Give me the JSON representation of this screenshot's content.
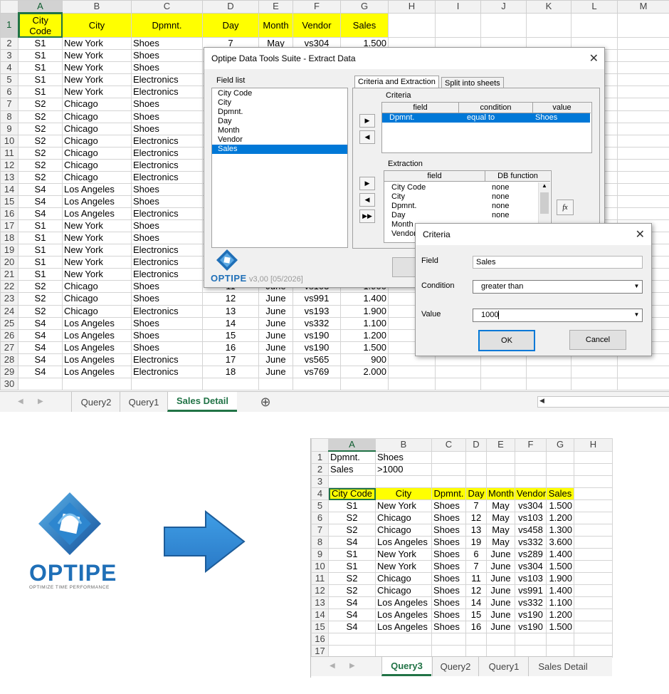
{
  "main_sheet": {
    "columns": [
      "A",
      "B",
      "C",
      "D",
      "E",
      "F",
      "G",
      "H",
      "I",
      "J",
      "K",
      "L",
      "M"
    ],
    "header_row": {
      "row": "1",
      "cells": [
        "City Code",
        "City",
        "Dpmnt.",
        "Day",
        "Month",
        "Vendor",
        "Sales"
      ]
    },
    "rows": [
      {
        "n": "2",
        "v": [
          "S1",
          "New York",
          "Shoes",
          "7",
          "May",
          "vs304",
          "1.500"
        ]
      },
      {
        "n": "3",
        "v": [
          "S1",
          "New York",
          "Shoes",
          "",
          "",
          "",
          ""
        ]
      },
      {
        "n": "4",
        "v": [
          "S1",
          "New York",
          "Shoes",
          "",
          "",
          "",
          ""
        ]
      },
      {
        "n": "5",
        "v": [
          "S1",
          "New York",
          "Electronics",
          "",
          "",
          "",
          ""
        ]
      },
      {
        "n": "6",
        "v": [
          "S1",
          "New York",
          "Electronics",
          "",
          "",
          "",
          ""
        ]
      },
      {
        "n": "7",
        "v": [
          "S2",
          "Chicago",
          "Shoes",
          "",
          "",
          "",
          ""
        ]
      },
      {
        "n": "8",
        "v": [
          "S2",
          "Chicago",
          "Shoes",
          "",
          "",
          "",
          ""
        ]
      },
      {
        "n": "9",
        "v": [
          "S2",
          "Chicago",
          "Shoes",
          "",
          "",
          "",
          ""
        ]
      },
      {
        "n": "10",
        "v": [
          "S2",
          "Chicago",
          "Electronics",
          "",
          "",
          "",
          ""
        ]
      },
      {
        "n": "11",
        "v": [
          "S2",
          "Chicago",
          "Electronics",
          "",
          "",
          "",
          ""
        ]
      },
      {
        "n": "12",
        "v": [
          "S2",
          "Chicago",
          "Electronics",
          "",
          "",
          "",
          ""
        ]
      },
      {
        "n": "13",
        "v": [
          "S2",
          "Chicago",
          "Electronics",
          "",
          "",
          "",
          ""
        ]
      },
      {
        "n": "14",
        "v": [
          "S4",
          "Los Angeles",
          "Shoes",
          "",
          "",
          "",
          ""
        ]
      },
      {
        "n": "15",
        "v": [
          "S4",
          "Los Angeles",
          "Shoes",
          "",
          "",
          "",
          ""
        ]
      },
      {
        "n": "16",
        "v": [
          "S4",
          "Los Angeles",
          "Electronics",
          "",
          "",
          "",
          ""
        ]
      },
      {
        "n": "17",
        "v": [
          "S1",
          "New York",
          "Shoes",
          "",
          "",
          "",
          ""
        ]
      },
      {
        "n": "18",
        "v": [
          "S1",
          "New York",
          "Shoes",
          "",
          "",
          "",
          ""
        ]
      },
      {
        "n": "19",
        "v": [
          "S1",
          "New York",
          "Electronics",
          "",
          "",
          "",
          ""
        ]
      },
      {
        "n": "20",
        "v": [
          "S1",
          "New York",
          "Electronics",
          "",
          "",
          "",
          ""
        ]
      },
      {
        "n": "21",
        "v": [
          "S1",
          "New York",
          "Electronics",
          "",
          "",
          "",
          ""
        ]
      },
      {
        "n": "22",
        "v": [
          "S2",
          "Chicago",
          "Shoes",
          "11",
          "June",
          "vs103",
          "1.900"
        ]
      },
      {
        "n": "23",
        "v": [
          "S2",
          "Chicago",
          "Shoes",
          "12",
          "June",
          "vs991",
          "1.400"
        ]
      },
      {
        "n": "24",
        "v": [
          "S2",
          "Chicago",
          "Electronics",
          "13",
          "June",
          "vs193",
          "1.900"
        ]
      },
      {
        "n": "25",
        "v": [
          "S4",
          "Los Angeles",
          "Shoes",
          "14",
          "June",
          "vs332",
          "1.100"
        ]
      },
      {
        "n": "26",
        "v": [
          "S4",
          "Los Angeles",
          "Shoes",
          "15",
          "June",
          "vs190",
          "1.200"
        ]
      },
      {
        "n": "27",
        "v": [
          "S4",
          "Los Angeles",
          "Shoes",
          "16",
          "June",
          "vs190",
          "1.500"
        ]
      },
      {
        "n": "28",
        "v": [
          "S4",
          "Los Angeles",
          "Electronics",
          "17",
          "June",
          "vs565",
          "900"
        ]
      },
      {
        "n": "29",
        "v": [
          "S4",
          "Los Angeles",
          "Electronics",
          "18",
          "June",
          "vs769",
          "2.000"
        ]
      },
      {
        "n": "30",
        "v": [
          "",
          "",
          "",
          "",
          "",
          "",
          ""
        ]
      }
    ],
    "tabs": [
      "Query2",
      "Query1",
      "Sales Detail"
    ],
    "add_sheet": "⊕"
  },
  "extract_dialog": {
    "title": "Optipe Data Tools Suite - Extract Data",
    "field_list_label": "Field list",
    "fields": [
      "City Code",
      "City",
      "Dpmnt.",
      "Day",
      "Month",
      "Vendor",
      "Sales"
    ],
    "selected_field": "Sales",
    "tabs": [
      "Criteria and Extraction",
      "Split into sheets"
    ],
    "criteria_label": "Criteria",
    "criteria_headers": [
      "field",
      "condition",
      "value"
    ],
    "criteria_row": [
      "Dpmnt.",
      "equal to",
      "Shoes"
    ],
    "extraction_label": "Extraction",
    "extraction_headers": [
      "field",
      "DB function"
    ],
    "extraction_rows": [
      [
        "City Code",
        "none"
      ],
      [
        "City",
        "none"
      ],
      [
        "Dpmnt.",
        "none"
      ],
      [
        "Day",
        "none"
      ],
      [
        "Month",
        ""
      ],
      [
        "Vendor",
        ""
      ]
    ],
    "fx_label": "fx",
    "brand": "OPTIPE",
    "version": "v3,00 [05/2026]"
  },
  "criteria_dialog": {
    "title": "Criteria",
    "field_label": "Field",
    "field_value": "Sales",
    "condition_label": "Condition",
    "condition_value": "greater than",
    "value_label": "Value",
    "value_value": "1000",
    "ok": "OK",
    "cancel": "Cancel"
  },
  "logo": {
    "name": "OPTIPE",
    "tagline": "OPTIMIZE TIME PERFORMANCE",
    "brand_color": "#1f6fb7"
  },
  "result_sheet": {
    "columns": [
      "A",
      "B",
      "C",
      "D",
      "E",
      "F",
      "G",
      "H"
    ],
    "criteria_rows": [
      {
        "n": "1",
        "v": [
          "Dpmnt.",
          "Shoes"
        ]
      },
      {
        "n": "2",
        "v": [
          "Sales",
          ">1000"
        ]
      },
      {
        "n": "3",
        "v": [
          "",
          ""
        ]
      }
    ],
    "header_row": {
      "n": "4",
      "cells": [
        "City Code",
        "City",
        "Dpmnt.",
        "Day",
        "Month",
        "Vendor",
        "Sales"
      ]
    },
    "rows": [
      {
        "n": "5",
        "v": [
          "S1",
          "New York",
          "Shoes",
          "7",
          "May",
          "vs304",
          "1.500"
        ]
      },
      {
        "n": "6",
        "v": [
          "S2",
          "Chicago",
          "Shoes",
          "12",
          "May",
          "vs103",
          "1.200"
        ]
      },
      {
        "n": "7",
        "v": [
          "S2",
          "Chicago",
          "Shoes",
          "13",
          "May",
          "vs458",
          "1.300"
        ]
      },
      {
        "n": "8",
        "v": [
          "S4",
          "Los Angeles",
          "Shoes",
          "19",
          "May",
          "vs332",
          "3.600"
        ]
      },
      {
        "n": "9",
        "v": [
          "S1",
          "New York",
          "Shoes",
          "6",
          "June",
          "vs289",
          "1.400"
        ]
      },
      {
        "n": "10",
        "v": [
          "S1",
          "New York",
          "Shoes",
          "7",
          "June",
          "vs304",
          "1.500"
        ]
      },
      {
        "n": "11",
        "v": [
          "S2",
          "Chicago",
          "Shoes",
          "11",
          "June",
          "vs103",
          "1.900"
        ]
      },
      {
        "n": "12",
        "v": [
          "S2",
          "Chicago",
          "Shoes",
          "12",
          "June",
          "vs991",
          "1.400"
        ]
      },
      {
        "n": "13",
        "v": [
          "S4",
          "Los Angeles",
          "Shoes",
          "14",
          "June",
          "vs332",
          "1.100"
        ]
      },
      {
        "n": "14",
        "v": [
          "S4",
          "Los Angeles",
          "Shoes",
          "15",
          "June",
          "vs190",
          "1.200"
        ]
      },
      {
        "n": "15",
        "v": [
          "S4",
          "Los Angeles",
          "Shoes",
          "16",
          "June",
          "vs190",
          "1.500"
        ]
      },
      {
        "n": "16",
        "v": [
          "",
          "",
          "",
          "",
          "",
          "",
          ""
        ]
      },
      {
        "n": "17",
        "v": [
          "",
          "",
          "",
          "",
          "",
          "",
          ""
        ]
      }
    ],
    "tabs": [
      "Query3",
      "Query2",
      "Query1",
      "Sales Detail"
    ]
  }
}
